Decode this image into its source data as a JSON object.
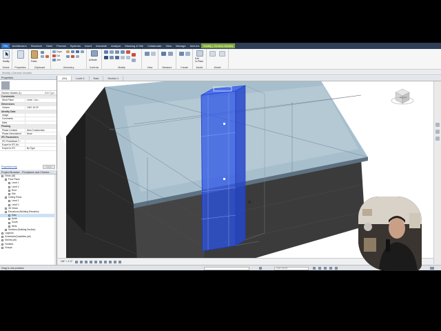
{
  "ribbon_tabs": [
    "File",
    "Architecture",
    "Structure",
    "Steel",
    "Precast",
    "Systems",
    "Insert",
    "Annotate",
    "Analyze",
    "Massing & Site",
    "Collaborate",
    "View",
    "Manage",
    "Add-Ins",
    "Modify | Generic Models"
  ],
  "active_tab": "Modify | Generic Models",
  "ribbon_panels": {
    "select": "Select",
    "properties": "Properties",
    "clipboard": "Clipboard",
    "geometry": "Geometry",
    "controls": "Controls",
    "modify": "Modify",
    "view": "View",
    "measure": "Measure",
    "create": "Create",
    "model": "Model",
    "model2": "Model"
  },
  "ribbon_buttons": {
    "modify": "Modify",
    "paste": "Paste",
    "activate": "Activate",
    "edit_in_place": "Edit\nIn-Place",
    "cope": "Cope",
    "cut": "Cut",
    "join": "Join"
  },
  "namebar": "Modify | Generic Models",
  "properties": {
    "header": "Properties",
    "type_name": "Generic Models (1)",
    "edit_type": "Edit Type",
    "sections": [
      {
        "title": "Constraints",
        "rows": [
          [
            "Work Plane",
            "Level : Lev..."
          ]
        ]
      },
      {
        "title": "Dimensions",
        "rows": [
          [
            "Volume",
            "1067.15 CF"
          ]
        ]
      },
      {
        "title": "Identity Data",
        "rows": [
          [
            "Image",
            ""
          ],
          [
            "Comments",
            ""
          ],
          [
            "Mark",
            ""
          ]
        ]
      },
      {
        "title": "Phasing",
        "rows": [
          [
            "Phase Created",
            "New Construction"
          ],
          [
            "Phase Demolished",
            "None"
          ]
        ]
      },
      {
        "title": "IFC Parameters",
        "rows": [
          [
            "IFC Predefined T...",
            ""
          ],
          [
            "Export to IFC As",
            ""
          ],
          [
            "Export to IFC",
            "By Type"
          ]
        ]
      }
    ],
    "help_link": "Properties help",
    "apply": "Apply"
  },
  "project_browser": {
    "header": "Project Browser - Fireplaces and Chimne...",
    "items": [
      {
        "label": "Views (all)",
        "indent": 0,
        "selected": false
      },
      {
        "label": "Floor Plans",
        "indent": 1,
        "selected": false
      },
      {
        "label": "Level 1",
        "indent": 2,
        "selected": false
      },
      {
        "label": "Level 2",
        "indent": 2,
        "selected": false
      },
      {
        "label": "Roof",
        "indent": 2,
        "selected": false
      },
      {
        "label": "Site",
        "indent": 2,
        "selected": false
      },
      {
        "label": "Ceiling Plans",
        "indent": 1,
        "selected": false
      },
      {
        "label": "Level 1",
        "indent": 2,
        "selected": false
      },
      {
        "label": "Level 2",
        "indent": 2,
        "selected": false
      },
      {
        "label": "3D Views",
        "indent": 1,
        "selected": false
      },
      {
        "label": "Elevations (Building Elevation)",
        "indent": 1,
        "selected": false
      },
      {
        "label": "East",
        "indent": 2,
        "selected": true
      },
      {
        "label": "North",
        "indent": 2,
        "selected": false
      },
      {
        "label": "South",
        "indent": 2,
        "selected": false
      },
      {
        "label": "West",
        "indent": 2,
        "selected": false
      },
      {
        "label": "Sections (Building Section)",
        "indent": 1,
        "selected": false
      },
      {
        "label": "Legends",
        "indent": 0,
        "selected": false
      },
      {
        "label": "Schedules/Quantities (all)",
        "indent": 0,
        "selected": false
      },
      {
        "label": "Sheets (all)",
        "indent": 0,
        "selected": false
      },
      {
        "label": "Families",
        "indent": 0,
        "selected": false
      },
      {
        "label": "Groups",
        "indent": 0,
        "selected": false
      }
    ]
  },
  "view_tabs": [
    {
      "label": "{3D}",
      "active": true
    },
    {
      "label": "Level 1",
      "active": false
    },
    {
      "label": "East",
      "active": false
    },
    {
      "label": "Section 1",
      "active": false
    }
  ],
  "view_scale": "1/8\" = 1'-0\"",
  "status_text": "Drag to new position",
  "status_main_model": "Main Model",
  "viewcube_label": "FRONT",
  "colors": {
    "ribbon_dark": "#2d3e55",
    "file_tab": "#2f72c4",
    "context_tab": "#7fa63a",
    "selection_blue": "#2e55e6",
    "wall_dark": "#333333",
    "roof_blue": "#9fb9c8"
  }
}
